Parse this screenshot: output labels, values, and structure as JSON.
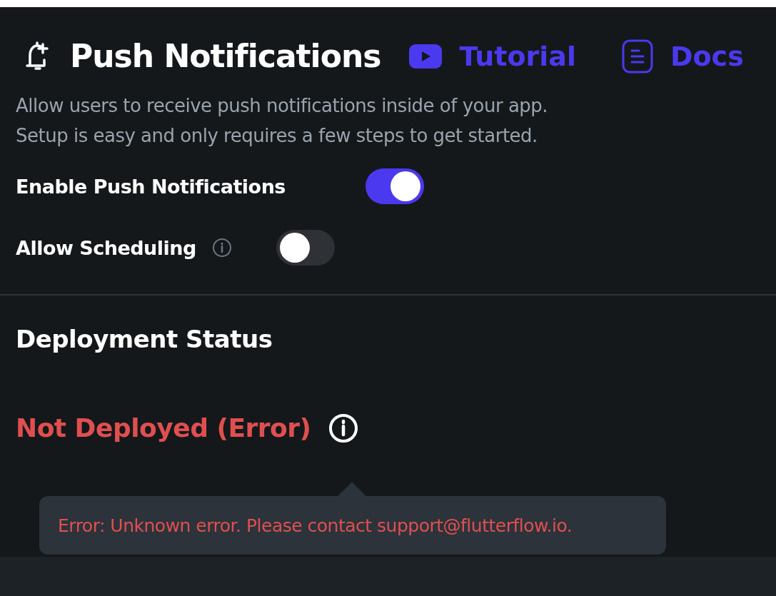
{
  "header": {
    "title": "Push Notifications",
    "links": [
      {
        "kind": "video",
        "label": "Tutorial"
      },
      {
        "kind": "doc",
        "label": "Docs"
      }
    ]
  },
  "description": [
    "Allow users to receive push notifications inside of your app.",
    "Setup is easy and only requires a few steps to get started."
  ],
  "settings": [
    {
      "label": "Enable Push Notifications",
      "info": false,
      "on": true
    },
    {
      "label": "Allow Scheduling",
      "info": true,
      "on": false
    }
  ],
  "deployment": {
    "heading": "Deployment Status",
    "status": "Not Deployed (Error)",
    "tooltip": "Error: Unknown error. Please contact support@flutterflow.io."
  }
}
